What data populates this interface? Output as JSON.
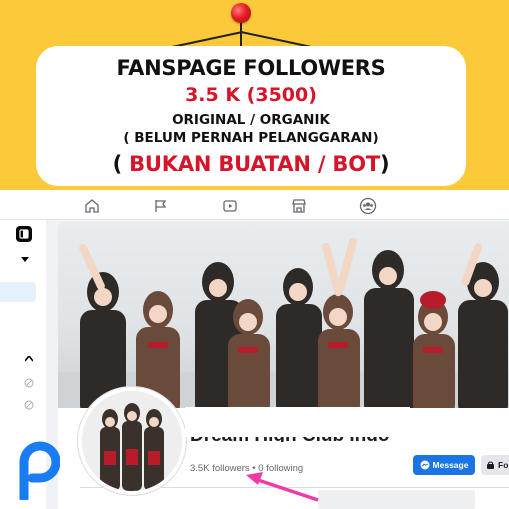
{
  "promo": {
    "title": "FANSPAGE FOLLOWERS",
    "count": "3.5 K (3500)",
    "line_original": "ORIGINAL / ORGANIK",
    "line_history": "( BELUM PERNAH PELANGGARAN)",
    "line_not_bot_open": "( ",
    "line_not_bot_red": "BUKAN BUATAN / BOT",
    "line_not_bot_close": ")"
  },
  "colors": {
    "background": "#fcc93a",
    "accent_red": "#d6152a",
    "facebook_blue": "#1b74e4"
  },
  "facebook": {
    "nav_icons": [
      "home-icon",
      "flag-icon",
      "video-icon",
      "marketplace-icon",
      "groups-icon"
    ],
    "page_name": "Dream High Club Indo",
    "followers_text": "3.5K followers • 0 following",
    "message_button": "Message",
    "follow_button": "Fo"
  },
  "logo": {
    "name": "picsart-p-logo"
  }
}
